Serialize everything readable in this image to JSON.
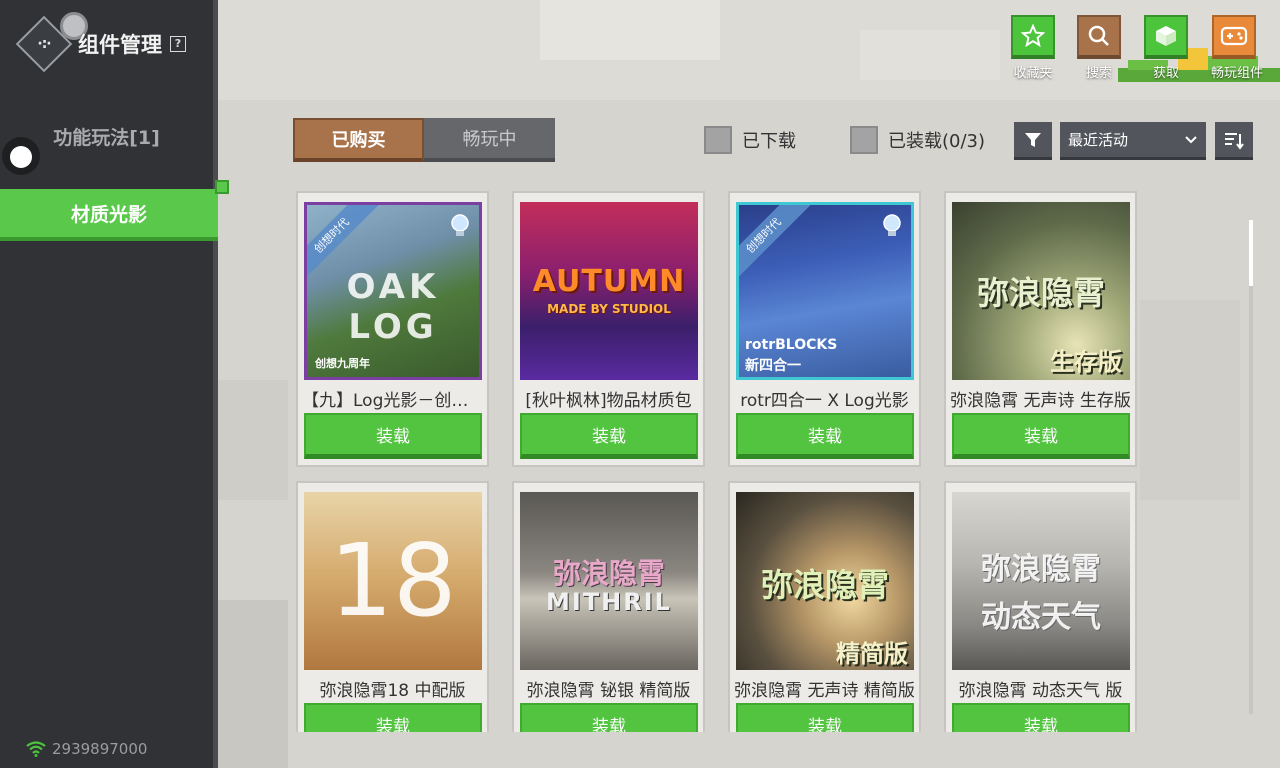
{
  "sidebar": {
    "title": "组件管理",
    "help_label": "?",
    "logo_glyph": "·:·",
    "items": [
      {
        "label": "功能玩法[1]",
        "active": false
      },
      {
        "label": "材质光影",
        "active": true
      }
    ],
    "network_id": "2939897000"
  },
  "toolbar": {
    "tools": [
      {
        "label": "收藏夹",
        "icon": "star-icon",
        "color": "#4cc43c"
      },
      {
        "label": "搜索",
        "icon": "search-icon",
        "color": "#a8734b"
      },
      {
        "label": "获取",
        "icon": "grass-block-icon",
        "color": "#4cc43c"
      },
      {
        "label": "畅玩组件",
        "icon": "gamepad-icon",
        "color": "#e98a3a"
      }
    ]
  },
  "tabs": [
    {
      "label": "已购买",
      "active": true
    },
    {
      "label": "畅玩中",
      "active": false
    }
  ],
  "filters": {
    "downloaded_label": "已下载",
    "equipped_label": "已装载(0/3)",
    "sort_value": "最近活动"
  },
  "cards": [
    {
      "title": "【九】Log光影－创想九周年",
      "thumb_text": "OAK LOG",
      "sub_text": "创想九周年",
      "ribbon": "创想时代",
      "button": "装载"
    },
    {
      "title": "[秋叶枫林]物品材质包",
      "thumb_text": "AUTUMN",
      "sub_text": "MADE BY STUDIOL",
      "ribbon": "",
      "button": "装载"
    },
    {
      "title": "rotr四合一 X Log光影",
      "thumb_text": "rotrBLOCKS",
      "sub_text": "新四合一",
      "ribbon": "创想时代",
      "button": "装载"
    },
    {
      "title": "弥浪隐霄 无声诗 生存版",
      "thumb_text": "弥浪隐霄",
      "sub_text": "生存版",
      "ribbon": "",
      "button": "装载"
    },
    {
      "title": "弥浪隐霄18 中配版",
      "thumb_text": "18",
      "sub_text": "",
      "ribbon": "",
      "button": "装载"
    },
    {
      "title": "弥浪隐霄 铋银 精简版",
      "thumb_text": "弥浪隐霄",
      "sub_text": "MITHRIL",
      "ribbon": "",
      "button": "装载"
    },
    {
      "title": "弥浪隐霄 无声诗 精简版",
      "thumb_text": "弥浪隐霄",
      "sub_text": "精简版",
      "ribbon": "",
      "button": "装载"
    },
    {
      "title": "弥浪隐霄 动态天气 版",
      "thumb_text": "弥浪隐霄",
      "sub_text": "动态天气",
      "ribbon": "",
      "button": "装载"
    }
  ]
}
